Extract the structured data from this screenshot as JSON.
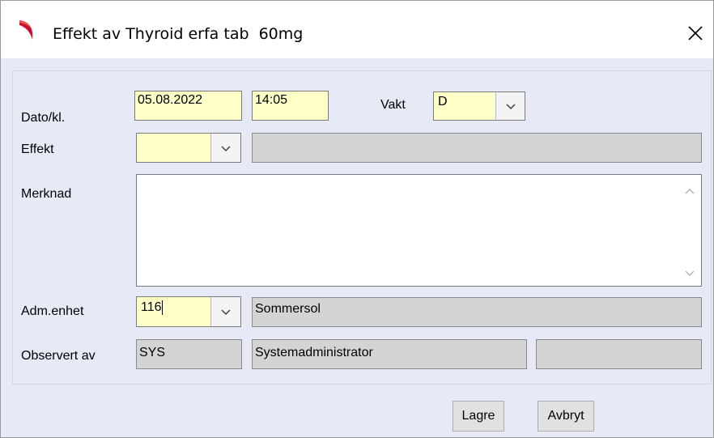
{
  "dialog": {
    "title": "Effekt av Thyroid erfa tab  60mg",
    "icons": {
      "app": "app-logo-icon",
      "close": "close-icon"
    }
  },
  "form": {
    "dato": {
      "label": "Dato/kl.",
      "date_value": "05.08.2022",
      "time_value": "14:05"
    },
    "vakt": {
      "label": "Vakt",
      "value": "D"
    },
    "effekt": {
      "label": "Effekt",
      "value": "",
      "description": ""
    },
    "merknad": {
      "label": "Merknad",
      "value": ""
    },
    "adm_enhet": {
      "label": "Adm.enhet",
      "value": "116",
      "description": "Sommersol"
    },
    "observert_av": {
      "label": "Observert av",
      "code": "SYS",
      "name": "Systemadministrator",
      "extra": ""
    }
  },
  "buttons": {
    "save": "Lagre",
    "cancel": "Avbryt"
  },
  "colors": {
    "window_bg": "#e6e9f6",
    "input_yellow": "#ffffc8",
    "readonly_grey": "#d4d4d4",
    "logo_red": "#c8102e"
  }
}
